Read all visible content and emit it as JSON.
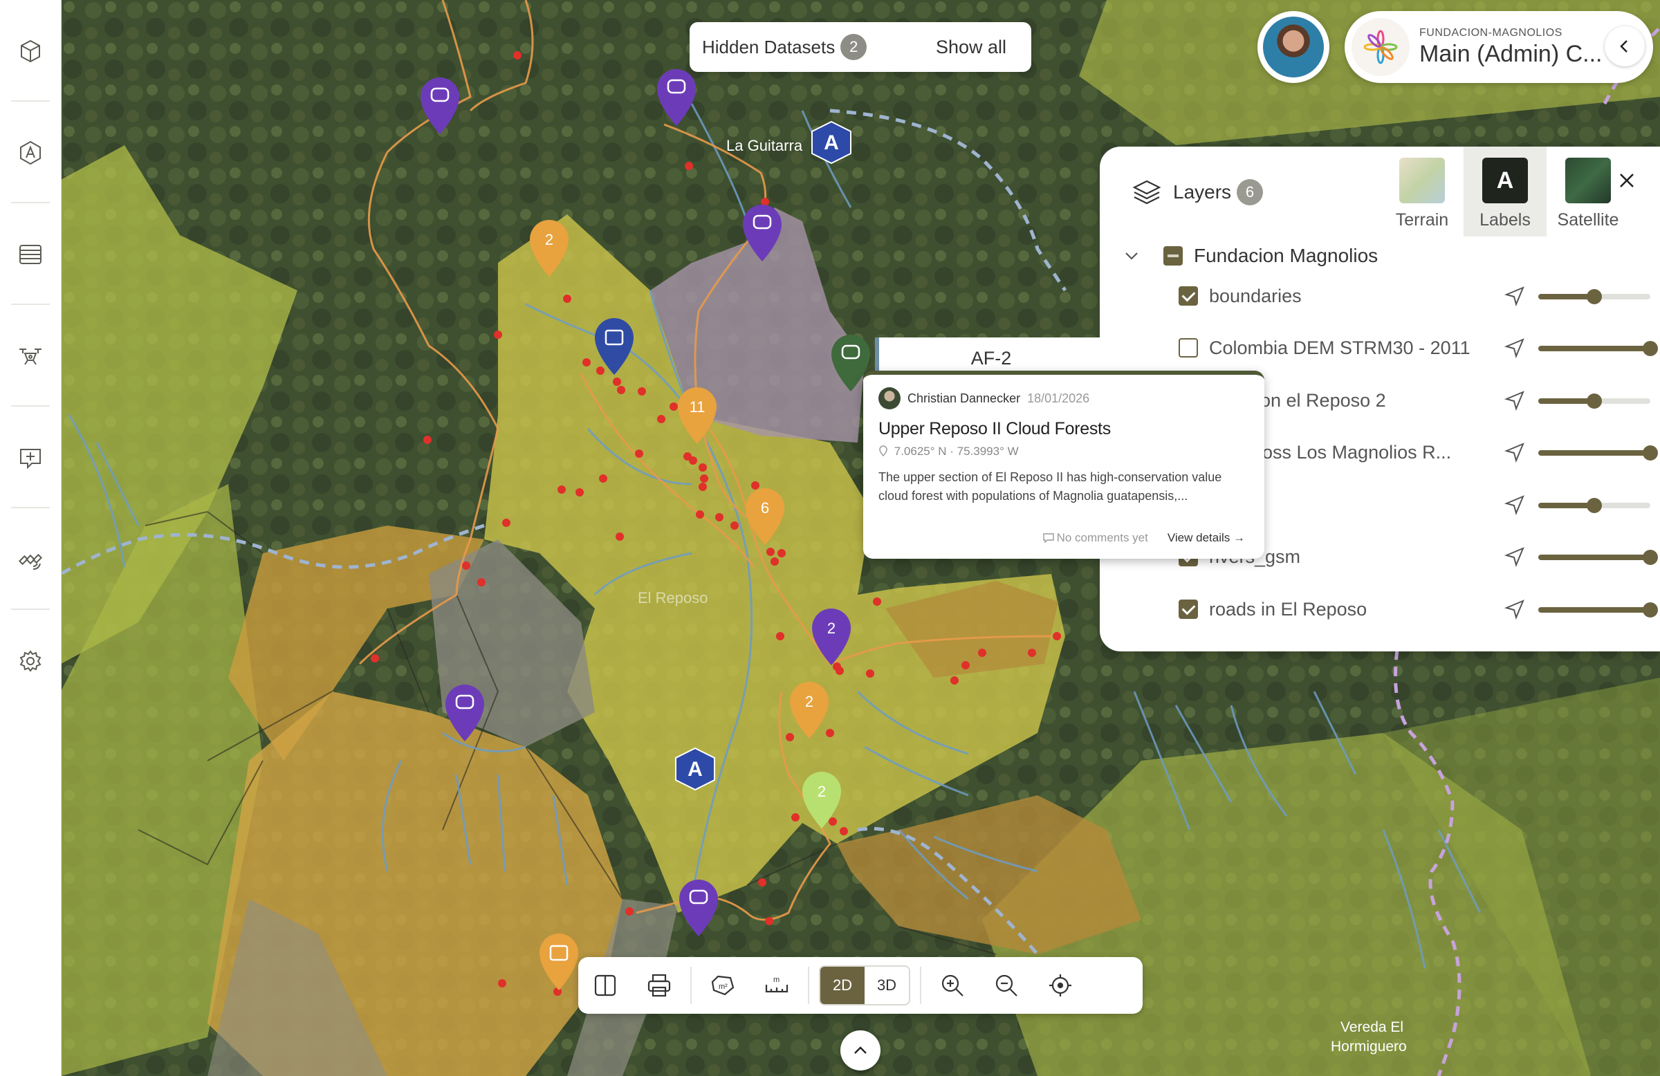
{
  "sidebar": {
    "items": [
      {
        "icon": "dataset-icon"
      },
      {
        "icon": "annotation-icon"
      },
      {
        "icon": "layers-list-icon"
      },
      {
        "icon": "drone-icon"
      },
      {
        "icon": "add-comment-icon"
      },
      {
        "icon": "satellite-icon"
      },
      {
        "icon": "settings-icon"
      }
    ]
  },
  "hidden_datasets": {
    "label": "Hidden Datasets",
    "count": "2",
    "action": "Show all"
  },
  "organization": {
    "subtitle": "FUNDACION-MAGNOLIOS",
    "name": "Main (Admin) C..."
  },
  "map": {
    "labels": {
      "la_guitarra": "La Guitarra",
      "el_reposo": "El Reposo",
      "vereda_1": "Vereda El",
      "vereda_2": "Hormiguero"
    },
    "markers": {
      "cluster_2a": "2",
      "cluster_11": "11",
      "cluster_6": "6",
      "cluster_2b": "2",
      "cluster_2c": "2",
      "cluster_2d": "2",
      "poi_a": "A"
    }
  },
  "layers_panel": {
    "title": "Layers",
    "count": "6",
    "basemaps": [
      {
        "label": "Terrain",
        "active": false
      },
      {
        "label": "Labels",
        "active": true,
        "glyph": "A"
      },
      {
        "label": "Satellite",
        "active": false
      }
    ],
    "group": "Fundacion Magnolios",
    "rows": [
      {
        "label": "boundaries",
        "checked": true,
        "opacity": 0.5
      },
      {
        "label": "Colombia DEM STRM30 - 2011",
        "checked": false,
        "opacity": 1.0
      },
      {
        "label": "ion el Reposo 2",
        "checked": null,
        "opacity": 0.5
      },
      {
        "label": "ross Los Magnolios R...",
        "checked": null,
        "opacity": 1.0
      },
      {
        "label": "",
        "checked": null,
        "opacity": 0.5
      },
      {
        "label": "rivers_gsm",
        "checked": true,
        "opacity": 1.0
      },
      {
        "label": "roads in El Reposo",
        "checked": true,
        "opacity": 1.0
      }
    ]
  },
  "feature_tab": {
    "label": "AF-2"
  },
  "popup": {
    "author": "Christian Dannecker",
    "date": "18/01/2026",
    "title": "Upper Reposo II Cloud Forests",
    "coords": "7.0625° N · 75.3993° W",
    "description_1": "The upper section of El Reposo II has high-conservation value",
    "description_2": "cloud forest with populations of Magnolia guatapensis,...",
    "comments": "No comments yet",
    "view_details": "View details"
  },
  "toolbar": {
    "mode_2d": "2D",
    "mode_3d": "3D",
    "active_mode": "2D"
  }
}
